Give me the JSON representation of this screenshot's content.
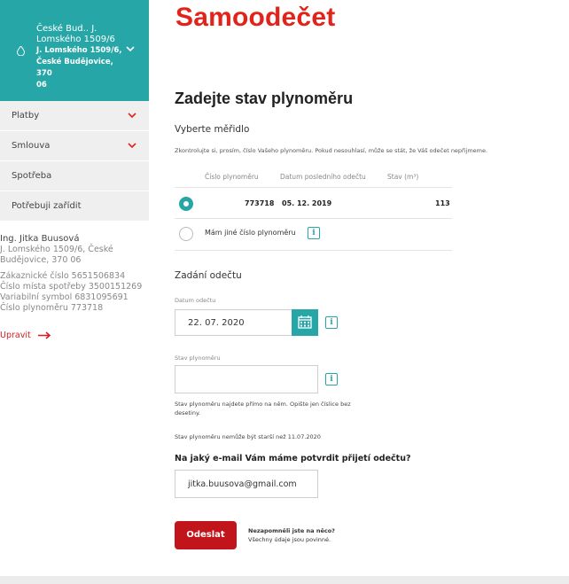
{
  "place": {
    "line1": "České Bud.. J.",
    "line2": "Lomského 1509/6",
    "line3": "J. Lomského 1509/6,",
    "line4": "České Budějovice, 370",
    "line5": "06"
  },
  "nav": {
    "items": [
      {
        "label": "Platby",
        "has_dropdown": true
      },
      {
        "label": "Smlouva",
        "has_dropdown": true
      },
      {
        "label": "Spotřeba",
        "has_dropdown": false
      },
      {
        "label": "Potřebuji zařídit",
        "has_dropdown": false
      }
    ]
  },
  "customer": {
    "name": "Ing. Jitka Buusová",
    "address1": "J. Lomského 1509/6, České",
    "address2": "Budějovice, 370 06",
    "customer_number": "Zákaznické číslo 5651506834",
    "place_number": "Číslo místa spotřeby 3500151269",
    "variable_symbol": "Variabilní symbol 6831095691",
    "meter_number": "Číslo plynoměru 773718",
    "edit_label": "Upravit"
  },
  "page": {
    "title": "Samoodečet",
    "section_title": "Zadejte stav plynoměru"
  },
  "meter_select": {
    "label": "Vyberte měřidlo",
    "hint": "Zkontrolujte si, prosím, číslo Vašeho plynoměru. Pokud nesouhlasí, může se stát, že Váš odečet nepřijmeme.",
    "columns": [
      "Číslo plynoměru",
      "Datum posledního odečtu",
      "Stav (m³)"
    ],
    "rows": [
      {
        "meter": "773718",
        "date": "05. 12. 2019",
        "state": "113",
        "selected": true
      }
    ],
    "other_option": "Mám jiné číslo plynoměru"
  },
  "reading": {
    "heading": "Zadání odečtu",
    "date_caption": "Datum odečtu",
    "date_value": "22. 07. 2020",
    "state_caption": "Stav plynoměru",
    "state_value": "",
    "state_note_line1": "Stav plynoměru najdete přímo na něm. Opište jen číslice bez",
    "state_note_line2": "desetiny.",
    "age_note": "Stav plynoměru nemůže být starší než 11.07.2020"
  },
  "confirm": {
    "question": "Na jaký e-mail Vám máme potvrdit přijetí odečtu?",
    "email": "jitka.buusova@gmail.com"
  },
  "submit": {
    "label": "Odeslat",
    "note_title": "Nezapomněli jste na něco?",
    "note_text": "Všechny údaje jsou povinné."
  },
  "colors": {
    "accent_teal": "#27a6a8",
    "brand_red": "#e2231a",
    "button_red": "#c2141b"
  },
  "icons": {
    "place": "drop-icon",
    "dropdown": "chevron-down-icon",
    "calendar": "calendar-icon",
    "info": "info-icon",
    "edit": "arrow-right-icon"
  }
}
